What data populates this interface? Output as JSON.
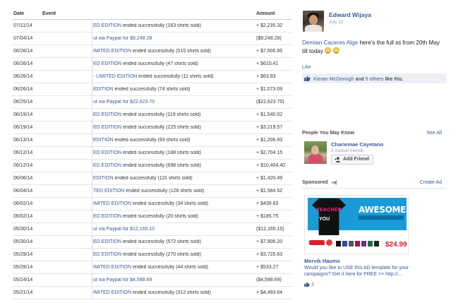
{
  "table": {
    "headers": {
      "date": "Date",
      "event": "Event",
      "amount": "Amount"
    },
    "rows": [
      {
        "date": "07/11/14",
        "event_link": "ED EDITION",
        "event_text": " ended successfully (163 shirts sold)",
        "amount": "+ $2,235.32"
      },
      {
        "date": "07/04/14",
        "event_payout": "ut via Paypal for $9,248.28",
        "amount": "($9,248.28)"
      },
      {
        "date": "06/26/14",
        "event_link": "IMITED EDITION",
        "event_text": " ended successfully (515 shirts sold)",
        "amount": "+ $7,500.85"
      },
      {
        "date": "06/26/14",
        "event_link": "ED EDITION",
        "event_text": " ended successfully (47 shirts sold)",
        "amount": "+ $610.41"
      },
      {
        "date": "06/26/14",
        "event_link": "- LIMITED EDITION",
        "event_text": " ended successfully (11 shirts sold)",
        "amount": "+ $63.93"
      },
      {
        "date": "06/26/14",
        "event_link": "EDITION",
        "event_text": " ended successfully (74 shirts sold)",
        "amount": "+ $1,073.09"
      },
      {
        "date": "06/25/14",
        "event_payout": "ut via Paypal for $22,623.70",
        "amount": "($22,623.70)"
      },
      {
        "date": "06/19/14",
        "event_link": "ED EDITION",
        "event_text": " ended successfully (119 shirts sold)",
        "amount": "+ $1,540.02"
      },
      {
        "date": "06/19/14",
        "event_link": "ED EDITION",
        "event_text": " ended successfully (225 shirts sold)",
        "amount": "+ $3,219.57"
      },
      {
        "date": "06/13/14",
        "event_link": "EDITION",
        "event_text": " ended successfully (93 shirts sold)",
        "amount": "+ $1,206.93"
      },
      {
        "date": "06/12/14",
        "event_link": "ED EDITION",
        "event_text": " ended successfully (188 shirts sold)",
        "amount": "+ $2,704.15"
      },
      {
        "date": "06/12/14",
        "event_link": "ED EDITION",
        "event_text": " ended successfully (698 shirts sold)",
        "amount": "+ $10,404.40"
      },
      {
        "date": "06/06/14",
        "event_link": "EDITION",
        "event_text": " ended successfully (115 shirts sold)",
        "amount": "+ $1,420.49"
      },
      {
        "date": "06/04/14",
        "event_link": "TED EDITION",
        "event_text": " ended successfully (126 shirts sold)",
        "amount": "+ $1,584.52"
      },
      {
        "date": "06/02/14",
        "event_link": "IMITED EDITION",
        "event_text": " ended successfully (34 shirts sold)",
        "amount": "+ $439.83"
      },
      {
        "date": "06/02/14",
        "event_link": "ED EDITION",
        "event_text": " ended successfully (20 shirts sold)",
        "amount": "+ $185.75"
      },
      {
        "date": "05/30/14",
        "event_payout": "ut via Paypal for $12,165.10",
        "amount": "($12,165.10)"
      },
      {
        "date": "05/30/14",
        "event_link": "ED EDITION",
        "event_text": " ended successfully (572 shirts sold)",
        "amount": "+ $7,906.20"
      },
      {
        "date": "05/29/14",
        "event_link": "ED EDITION",
        "event_text": " ended successfully (270 shirts sold)",
        "amount": "+ $3,725.63"
      },
      {
        "date": "05/29/14",
        "event_link": "IMITED EDITION",
        "event_text": " ended successfully (44 shirts sold)",
        "amount": "+ $533.27"
      },
      {
        "date": "05/24/14",
        "event_payout": "ut via Paypal for $4,588.69",
        "amount": "($4,588.69)"
      },
      {
        "date": "05/21/14",
        "event_link": "IMITED EDITION",
        "event_text": " ended successfully (312 shirts sold)",
        "amount": "+ $4,493.64"
      }
    ]
  },
  "post": {
    "author": "Edward Wijaya",
    "date": "July 11",
    "mention": "Demian Caceres Alge",
    "text": " here's the full ss from 20th May till today ",
    "like_link": "Like",
    "likes_person": "Kieran McDonogh",
    "likes_and": " and ",
    "likes_others": "5 others",
    "likes_suffix": " like this."
  },
  "pymk": {
    "title": "People You May Know",
    "see_all": "See All",
    "name": "Chariemae Cayetano",
    "mutual": "2 mutual friends",
    "add_friend": "Add Friend"
  },
  "sponsored": {
    "title": "Sponsored",
    "create_ad": "Create Ad",
    "ad_shirt_line1": "TEACHER",
    "ad_shirt_line2": "YOU",
    "ad_awesome": "AWESOME",
    "ad_price": "$24.99",
    "ad_name": "Mervik Haums",
    "ad_text": "Would you like to USE this AD template for your campaigns? Get it here for FREE >> http://...",
    "ad_likes": "2"
  },
  "colors": {
    "link": "#3b5998",
    "meta": "#9197a3",
    "likes_bg": "#edeff4",
    "ad_banner": "#1a9bd8",
    "price_red": "#d6212a"
  }
}
